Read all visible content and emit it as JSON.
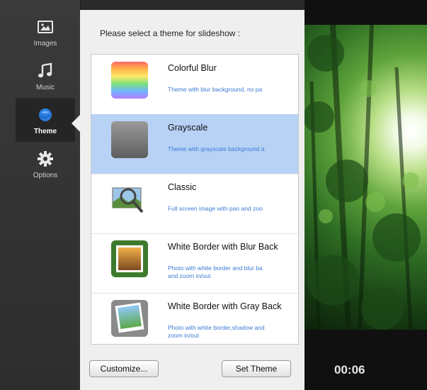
{
  "sidebar": {
    "items": [
      {
        "label": "Images",
        "icon": "image-icon"
      },
      {
        "label": "Music",
        "icon": "music-note-icon"
      },
      {
        "label": "Theme",
        "icon": "theme-icon",
        "active": true
      },
      {
        "label": "Options",
        "icon": "gear-icon"
      }
    ]
  },
  "panel": {
    "prompt": "Please select a theme for slideshow :",
    "themes": [
      {
        "title": "Colorful Blur",
        "desc": "Theme with blur background, no pa"
      },
      {
        "title": "Grayscale",
        "desc": "Theme with grayscale background a",
        "selected": true
      },
      {
        "title": "Classic",
        "desc": "Full screen image with pan and zoo"
      },
      {
        "title": "White Border with Blur Back",
        "desc": "Photo with white border and blur ba",
        "desc2": "and zoom in/out"
      },
      {
        "title": "White Border with Gray Back",
        "desc": "Photo with white border,shadow and",
        "desc2": "zoom in/out"
      }
    ],
    "customize_label": "Customize...",
    "set_theme_label": "Set Theme"
  },
  "preview": {
    "time": "00:06"
  },
  "colors": {
    "selected_row": "#b7d2f5",
    "desc_text": "#3d7bd5",
    "active_theme_icon": "#2a7de1"
  }
}
